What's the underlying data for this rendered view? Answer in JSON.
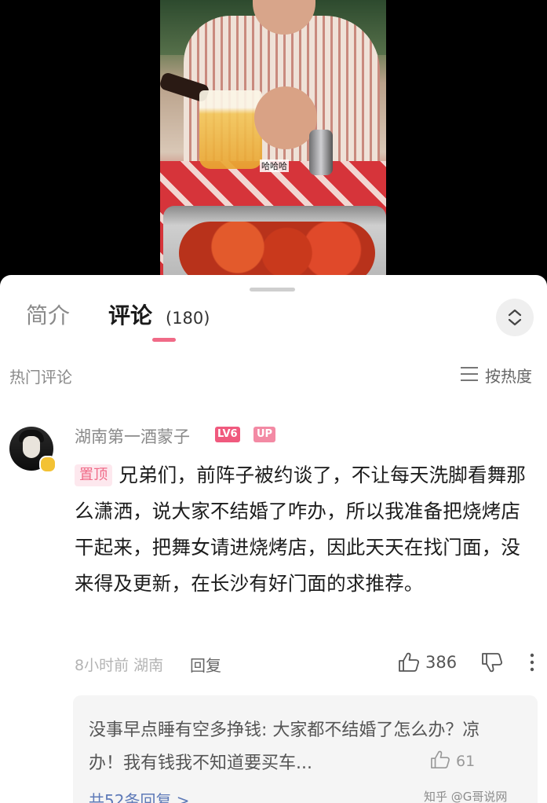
{
  "video": {
    "caption": "哈哈哈"
  },
  "tabs": {
    "intro": "简介",
    "comments": "评论",
    "comments_count": "(180)"
  },
  "section": {
    "hot_label": "热门评论",
    "sort_label": "按热度"
  },
  "comment": {
    "username": "湖南第一酒蒙子",
    "level_badge": "LV6",
    "up_badge": "UP",
    "pinned_tag": "置顶",
    "text": "兄弟们，前阵子被约谈了，不让每天洗脚看舞那么潇洒，说大家不结婚了咋办，所以我准备把烧烤店干起来，把舞女请进烧烤店，因此天天在找门面，没来得及更新，在长沙有好门面的求推荐。",
    "time": "8小时前",
    "location": "湖南",
    "reply_label": "回复",
    "like_count": "386"
  },
  "reply": {
    "text": "没事早点睡有空多挣钱: 大家都不结婚了怎么办？凉办！我有钱我不知道要买车...",
    "like_count": "61",
    "total_label": "共52条回复 >"
  },
  "watermark": "知乎 @G哥说网",
  "colors": {
    "accent_pink": "#f06a87",
    "level_badge": "#f05a7e",
    "link_blue": "#5e7ab8"
  }
}
